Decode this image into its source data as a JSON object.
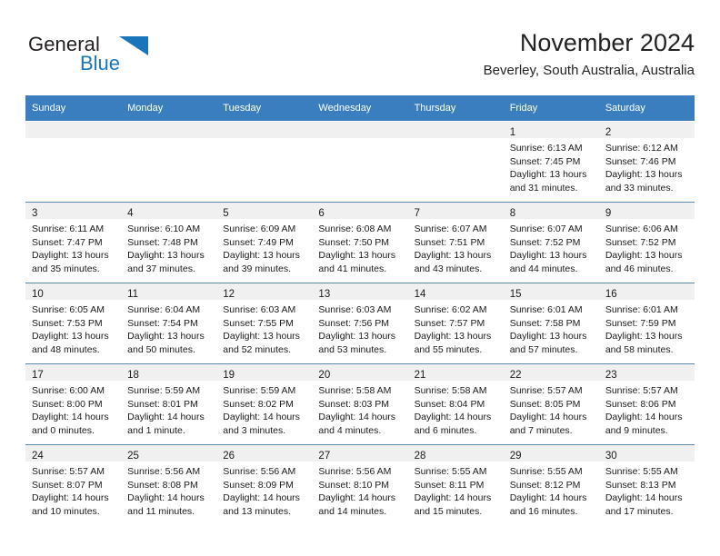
{
  "brand": {
    "word1": "General",
    "word2": "Blue",
    "logo_icon": "triangle-flag-icon",
    "accent_color": "#1b75bb"
  },
  "header": {
    "title": "November 2024",
    "subtitle": "Beverley, South Australia, Australia"
  },
  "calendar": {
    "header_bg": "#3b7ebf",
    "daynum_band_bg": "#f0f0f0",
    "weekday_headers": [
      "Sunday",
      "Monday",
      "Tuesday",
      "Wednesday",
      "Thursday",
      "Friday",
      "Saturday"
    ],
    "weeks": [
      [
        {
          "day": "",
          "empty": true
        },
        {
          "day": "",
          "empty": true
        },
        {
          "day": "",
          "empty": true
        },
        {
          "day": "",
          "empty": true
        },
        {
          "day": "",
          "empty": true
        },
        {
          "day": "1",
          "sunrise": "Sunrise: 6:13 AM",
          "sunset": "Sunset: 7:45 PM",
          "daylight1": "Daylight: 13 hours",
          "daylight2": "and 31 minutes."
        },
        {
          "day": "2",
          "sunrise": "Sunrise: 6:12 AM",
          "sunset": "Sunset: 7:46 PM",
          "daylight1": "Daylight: 13 hours",
          "daylight2": "and 33 minutes."
        }
      ],
      [
        {
          "day": "3",
          "sunrise": "Sunrise: 6:11 AM",
          "sunset": "Sunset: 7:47 PM",
          "daylight1": "Daylight: 13 hours",
          "daylight2": "and 35 minutes."
        },
        {
          "day": "4",
          "sunrise": "Sunrise: 6:10 AM",
          "sunset": "Sunset: 7:48 PM",
          "daylight1": "Daylight: 13 hours",
          "daylight2": "and 37 minutes."
        },
        {
          "day": "5",
          "sunrise": "Sunrise: 6:09 AM",
          "sunset": "Sunset: 7:49 PM",
          "daylight1": "Daylight: 13 hours",
          "daylight2": "and 39 minutes."
        },
        {
          "day": "6",
          "sunrise": "Sunrise: 6:08 AM",
          "sunset": "Sunset: 7:50 PM",
          "daylight1": "Daylight: 13 hours",
          "daylight2": "and 41 minutes."
        },
        {
          "day": "7",
          "sunrise": "Sunrise: 6:07 AM",
          "sunset": "Sunset: 7:51 PM",
          "daylight1": "Daylight: 13 hours",
          "daylight2": "and 43 minutes."
        },
        {
          "day": "8",
          "sunrise": "Sunrise: 6:07 AM",
          "sunset": "Sunset: 7:52 PM",
          "daylight1": "Daylight: 13 hours",
          "daylight2": "and 44 minutes."
        },
        {
          "day": "9",
          "sunrise": "Sunrise: 6:06 AM",
          "sunset": "Sunset: 7:52 PM",
          "daylight1": "Daylight: 13 hours",
          "daylight2": "and 46 minutes."
        }
      ],
      [
        {
          "day": "10",
          "sunrise": "Sunrise: 6:05 AM",
          "sunset": "Sunset: 7:53 PM",
          "daylight1": "Daylight: 13 hours",
          "daylight2": "and 48 minutes."
        },
        {
          "day": "11",
          "sunrise": "Sunrise: 6:04 AM",
          "sunset": "Sunset: 7:54 PM",
          "daylight1": "Daylight: 13 hours",
          "daylight2": "and 50 minutes."
        },
        {
          "day": "12",
          "sunrise": "Sunrise: 6:03 AM",
          "sunset": "Sunset: 7:55 PM",
          "daylight1": "Daylight: 13 hours",
          "daylight2": "and 52 minutes."
        },
        {
          "day": "13",
          "sunrise": "Sunrise: 6:03 AM",
          "sunset": "Sunset: 7:56 PM",
          "daylight1": "Daylight: 13 hours",
          "daylight2": "and 53 minutes."
        },
        {
          "day": "14",
          "sunrise": "Sunrise: 6:02 AM",
          "sunset": "Sunset: 7:57 PM",
          "daylight1": "Daylight: 13 hours",
          "daylight2": "and 55 minutes."
        },
        {
          "day": "15",
          "sunrise": "Sunrise: 6:01 AM",
          "sunset": "Sunset: 7:58 PM",
          "daylight1": "Daylight: 13 hours",
          "daylight2": "and 57 minutes."
        },
        {
          "day": "16",
          "sunrise": "Sunrise: 6:01 AM",
          "sunset": "Sunset: 7:59 PM",
          "daylight1": "Daylight: 13 hours",
          "daylight2": "and 58 minutes."
        }
      ],
      [
        {
          "day": "17",
          "sunrise": "Sunrise: 6:00 AM",
          "sunset": "Sunset: 8:00 PM",
          "daylight1": "Daylight: 14 hours",
          "daylight2": "and 0 minutes."
        },
        {
          "day": "18",
          "sunrise": "Sunrise: 5:59 AM",
          "sunset": "Sunset: 8:01 PM",
          "daylight1": "Daylight: 14 hours",
          "daylight2": "and 1 minute."
        },
        {
          "day": "19",
          "sunrise": "Sunrise: 5:59 AM",
          "sunset": "Sunset: 8:02 PM",
          "daylight1": "Daylight: 14 hours",
          "daylight2": "and 3 minutes."
        },
        {
          "day": "20",
          "sunrise": "Sunrise: 5:58 AM",
          "sunset": "Sunset: 8:03 PM",
          "daylight1": "Daylight: 14 hours",
          "daylight2": "and 4 minutes."
        },
        {
          "day": "21",
          "sunrise": "Sunrise: 5:58 AM",
          "sunset": "Sunset: 8:04 PM",
          "daylight1": "Daylight: 14 hours",
          "daylight2": "and 6 minutes."
        },
        {
          "day": "22",
          "sunrise": "Sunrise: 5:57 AM",
          "sunset": "Sunset: 8:05 PM",
          "daylight1": "Daylight: 14 hours",
          "daylight2": "and 7 minutes."
        },
        {
          "day": "23",
          "sunrise": "Sunrise: 5:57 AM",
          "sunset": "Sunset: 8:06 PM",
          "daylight1": "Daylight: 14 hours",
          "daylight2": "and 9 minutes."
        }
      ],
      [
        {
          "day": "24",
          "sunrise": "Sunrise: 5:57 AM",
          "sunset": "Sunset: 8:07 PM",
          "daylight1": "Daylight: 14 hours",
          "daylight2": "and 10 minutes."
        },
        {
          "day": "25",
          "sunrise": "Sunrise: 5:56 AM",
          "sunset": "Sunset: 8:08 PM",
          "daylight1": "Daylight: 14 hours",
          "daylight2": "and 11 minutes."
        },
        {
          "day": "26",
          "sunrise": "Sunrise: 5:56 AM",
          "sunset": "Sunset: 8:09 PM",
          "daylight1": "Daylight: 14 hours",
          "daylight2": "and 13 minutes."
        },
        {
          "day": "27",
          "sunrise": "Sunrise: 5:56 AM",
          "sunset": "Sunset: 8:10 PM",
          "daylight1": "Daylight: 14 hours",
          "daylight2": "and 14 minutes."
        },
        {
          "day": "28",
          "sunrise": "Sunrise: 5:55 AM",
          "sunset": "Sunset: 8:11 PM",
          "daylight1": "Daylight: 14 hours",
          "daylight2": "and 15 minutes."
        },
        {
          "day": "29",
          "sunrise": "Sunrise: 5:55 AM",
          "sunset": "Sunset: 8:12 PM",
          "daylight1": "Daylight: 14 hours",
          "daylight2": "and 16 minutes."
        },
        {
          "day": "30",
          "sunrise": "Sunrise: 5:55 AM",
          "sunset": "Sunset: 8:13 PM",
          "daylight1": "Daylight: 14 hours",
          "daylight2": "and 17 minutes."
        }
      ]
    ]
  }
}
